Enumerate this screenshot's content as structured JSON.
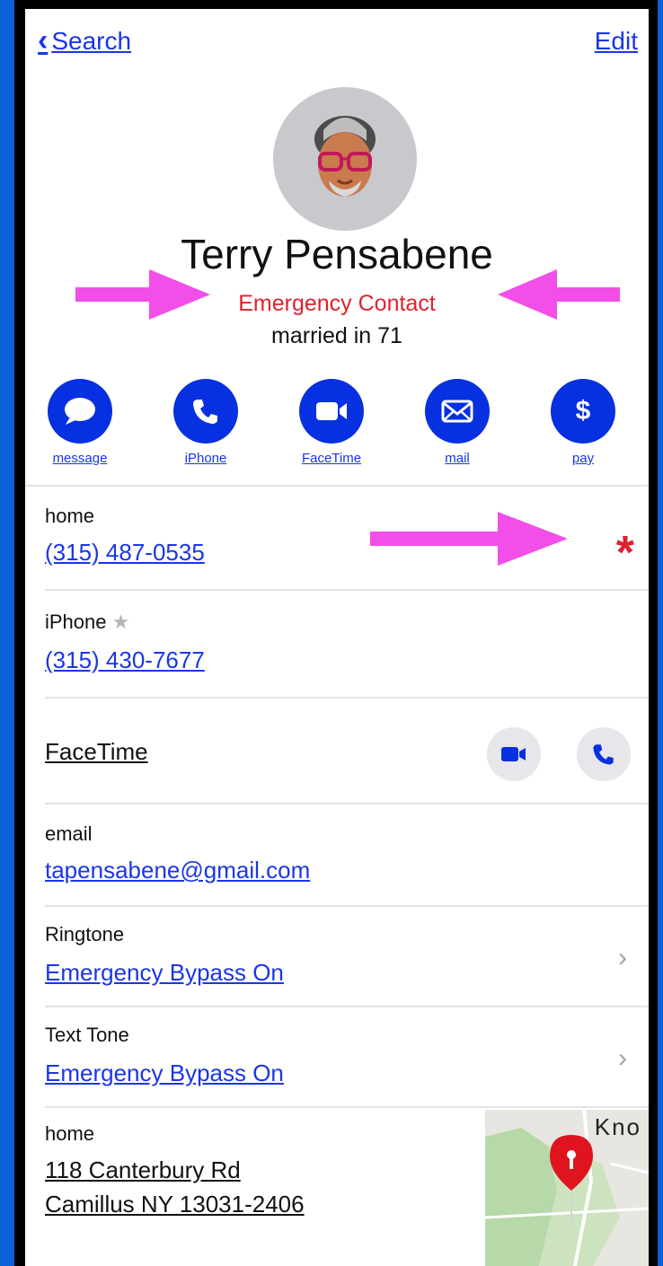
{
  "nav": {
    "back_label": "Search",
    "edit_label": "Edit"
  },
  "contact": {
    "name": "Terry Pensabene",
    "subtitle": "Emergency Contact",
    "note": "married in 71"
  },
  "actions": [
    {
      "label": "message",
      "icon": "message-bubble-icon"
    },
    {
      "label": "iPhone",
      "icon": "phone-icon"
    },
    {
      "label": "FaceTime",
      "icon": "video-camera-icon"
    },
    {
      "label": "mail",
      "icon": "envelope-icon"
    },
    {
      "label": "pay",
      "icon": "dollar-icon"
    }
  ],
  "phones": [
    {
      "label": "home",
      "number": "(315) 487-0535",
      "emergency_marker": "*"
    },
    {
      "label": "iPhone",
      "number": "(315) 430-7677",
      "favorite_icon": "star-icon"
    }
  ],
  "facetime": {
    "label": "FaceTime"
  },
  "email": {
    "label": "email",
    "value": "tapensabene@gmail.com"
  },
  "ringtone": {
    "label": "Ringtone",
    "value": "Emergency Bypass On"
  },
  "text_tone": {
    "label": "Text Tone",
    "value": "Emergency Bypass On"
  },
  "address": {
    "label": "home",
    "line1": "118 Canterbury Rd",
    "line2": "Camillus NY 13031-2406",
    "map_text": "Kno"
  },
  "colors": {
    "accent": "#1a36e6",
    "action_circle": "#0630e0",
    "emergency": "#e0212f",
    "annotation_arrow": "#f24ee8",
    "background": "#0a62d6"
  }
}
